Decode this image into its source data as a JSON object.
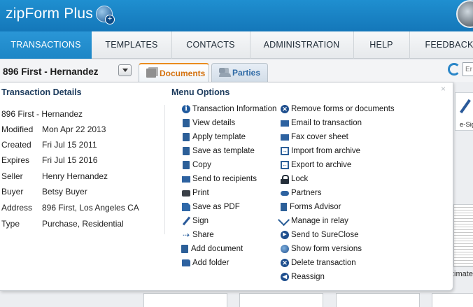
{
  "header": {
    "app_title": "zipForm Plus"
  },
  "nav": {
    "items": [
      {
        "label": "TRANSACTIONS"
      },
      {
        "label": "TEMPLATES"
      },
      {
        "label": "CONTACTS"
      },
      {
        "label": "ADMINISTRATION"
      },
      {
        "label": "HELP"
      },
      {
        "label": "FEEDBACK"
      }
    ],
    "active": "TRANSACTIONS"
  },
  "transaction_bar": {
    "name": "896 First - Hernandez",
    "tabs": [
      {
        "label": "Documents"
      },
      {
        "label": "Parties"
      }
    ],
    "search": {
      "value": "Er"
    }
  },
  "background": {
    "esign_label": "e-Sig",
    "estimate_label": "timate"
  },
  "popup": {
    "close": "×",
    "details_title": "Transaction Details",
    "menu_title": "Menu Options",
    "transaction_name": "896 First - Hernandez",
    "details": [
      {
        "label": "Modified",
        "value": "Mon Apr 22 2013"
      },
      {
        "label": "Created",
        "value": "Fri Jul 15 2011"
      },
      {
        "label": "Expires",
        "value": "Fri Jul 15 2016"
      },
      {
        "label": "Seller",
        "value": "Henry Hernandez"
      },
      {
        "label": "Buyer",
        "value": "Betsy Buyer"
      },
      {
        "label": "Address",
        "value": "896 First, Los Angeles CA"
      },
      {
        "label": "Type",
        "value": "Purchase, Residential"
      }
    ],
    "menu_left": [
      {
        "label": "Transaction Information",
        "icon": "info-icon"
      },
      {
        "label": "View details",
        "icon": "document-icon"
      },
      {
        "label": "Apply template",
        "icon": "document-icon"
      },
      {
        "label": "Save as template",
        "icon": "document-icon"
      },
      {
        "label": "Copy",
        "icon": "copy-icon"
      },
      {
        "label": "Send to recipients",
        "icon": "mail-icon"
      },
      {
        "label": "Print",
        "icon": "printer-icon"
      },
      {
        "label": "Save as PDF",
        "icon": "pdf-icon"
      },
      {
        "label": "Sign",
        "icon": "pen-icon"
      },
      {
        "label": "Share",
        "icon": "share-icon"
      },
      {
        "label": "Add document",
        "icon": "document-icon"
      },
      {
        "label": "Add folder",
        "icon": "folder-icon"
      }
    ],
    "menu_right": [
      {
        "label": "Remove forms or documents",
        "icon": "remove-icon"
      },
      {
        "label": "Email to transaction",
        "icon": "mail-icon"
      },
      {
        "label": "Fax cover sheet",
        "icon": "fax-icon"
      },
      {
        "label": "Import from archive",
        "icon": "import-icon"
      },
      {
        "label": "Export to archive",
        "icon": "export-icon"
      },
      {
        "label": "Lock",
        "icon": "lock-icon"
      },
      {
        "label": "Partners",
        "icon": "handshake-icon"
      },
      {
        "label": "Forms Advisor",
        "icon": "advisor-icon"
      },
      {
        "label": "Manage in relay",
        "icon": "relay-icon"
      },
      {
        "label": "Send to SureClose",
        "icon": "play-icon"
      },
      {
        "label": "Show form versions",
        "icon": "globe-icon"
      },
      {
        "label": "Delete transaction",
        "icon": "delete-icon"
      },
      {
        "label": "Reassign",
        "icon": "reassign-icon"
      }
    ]
  }
}
